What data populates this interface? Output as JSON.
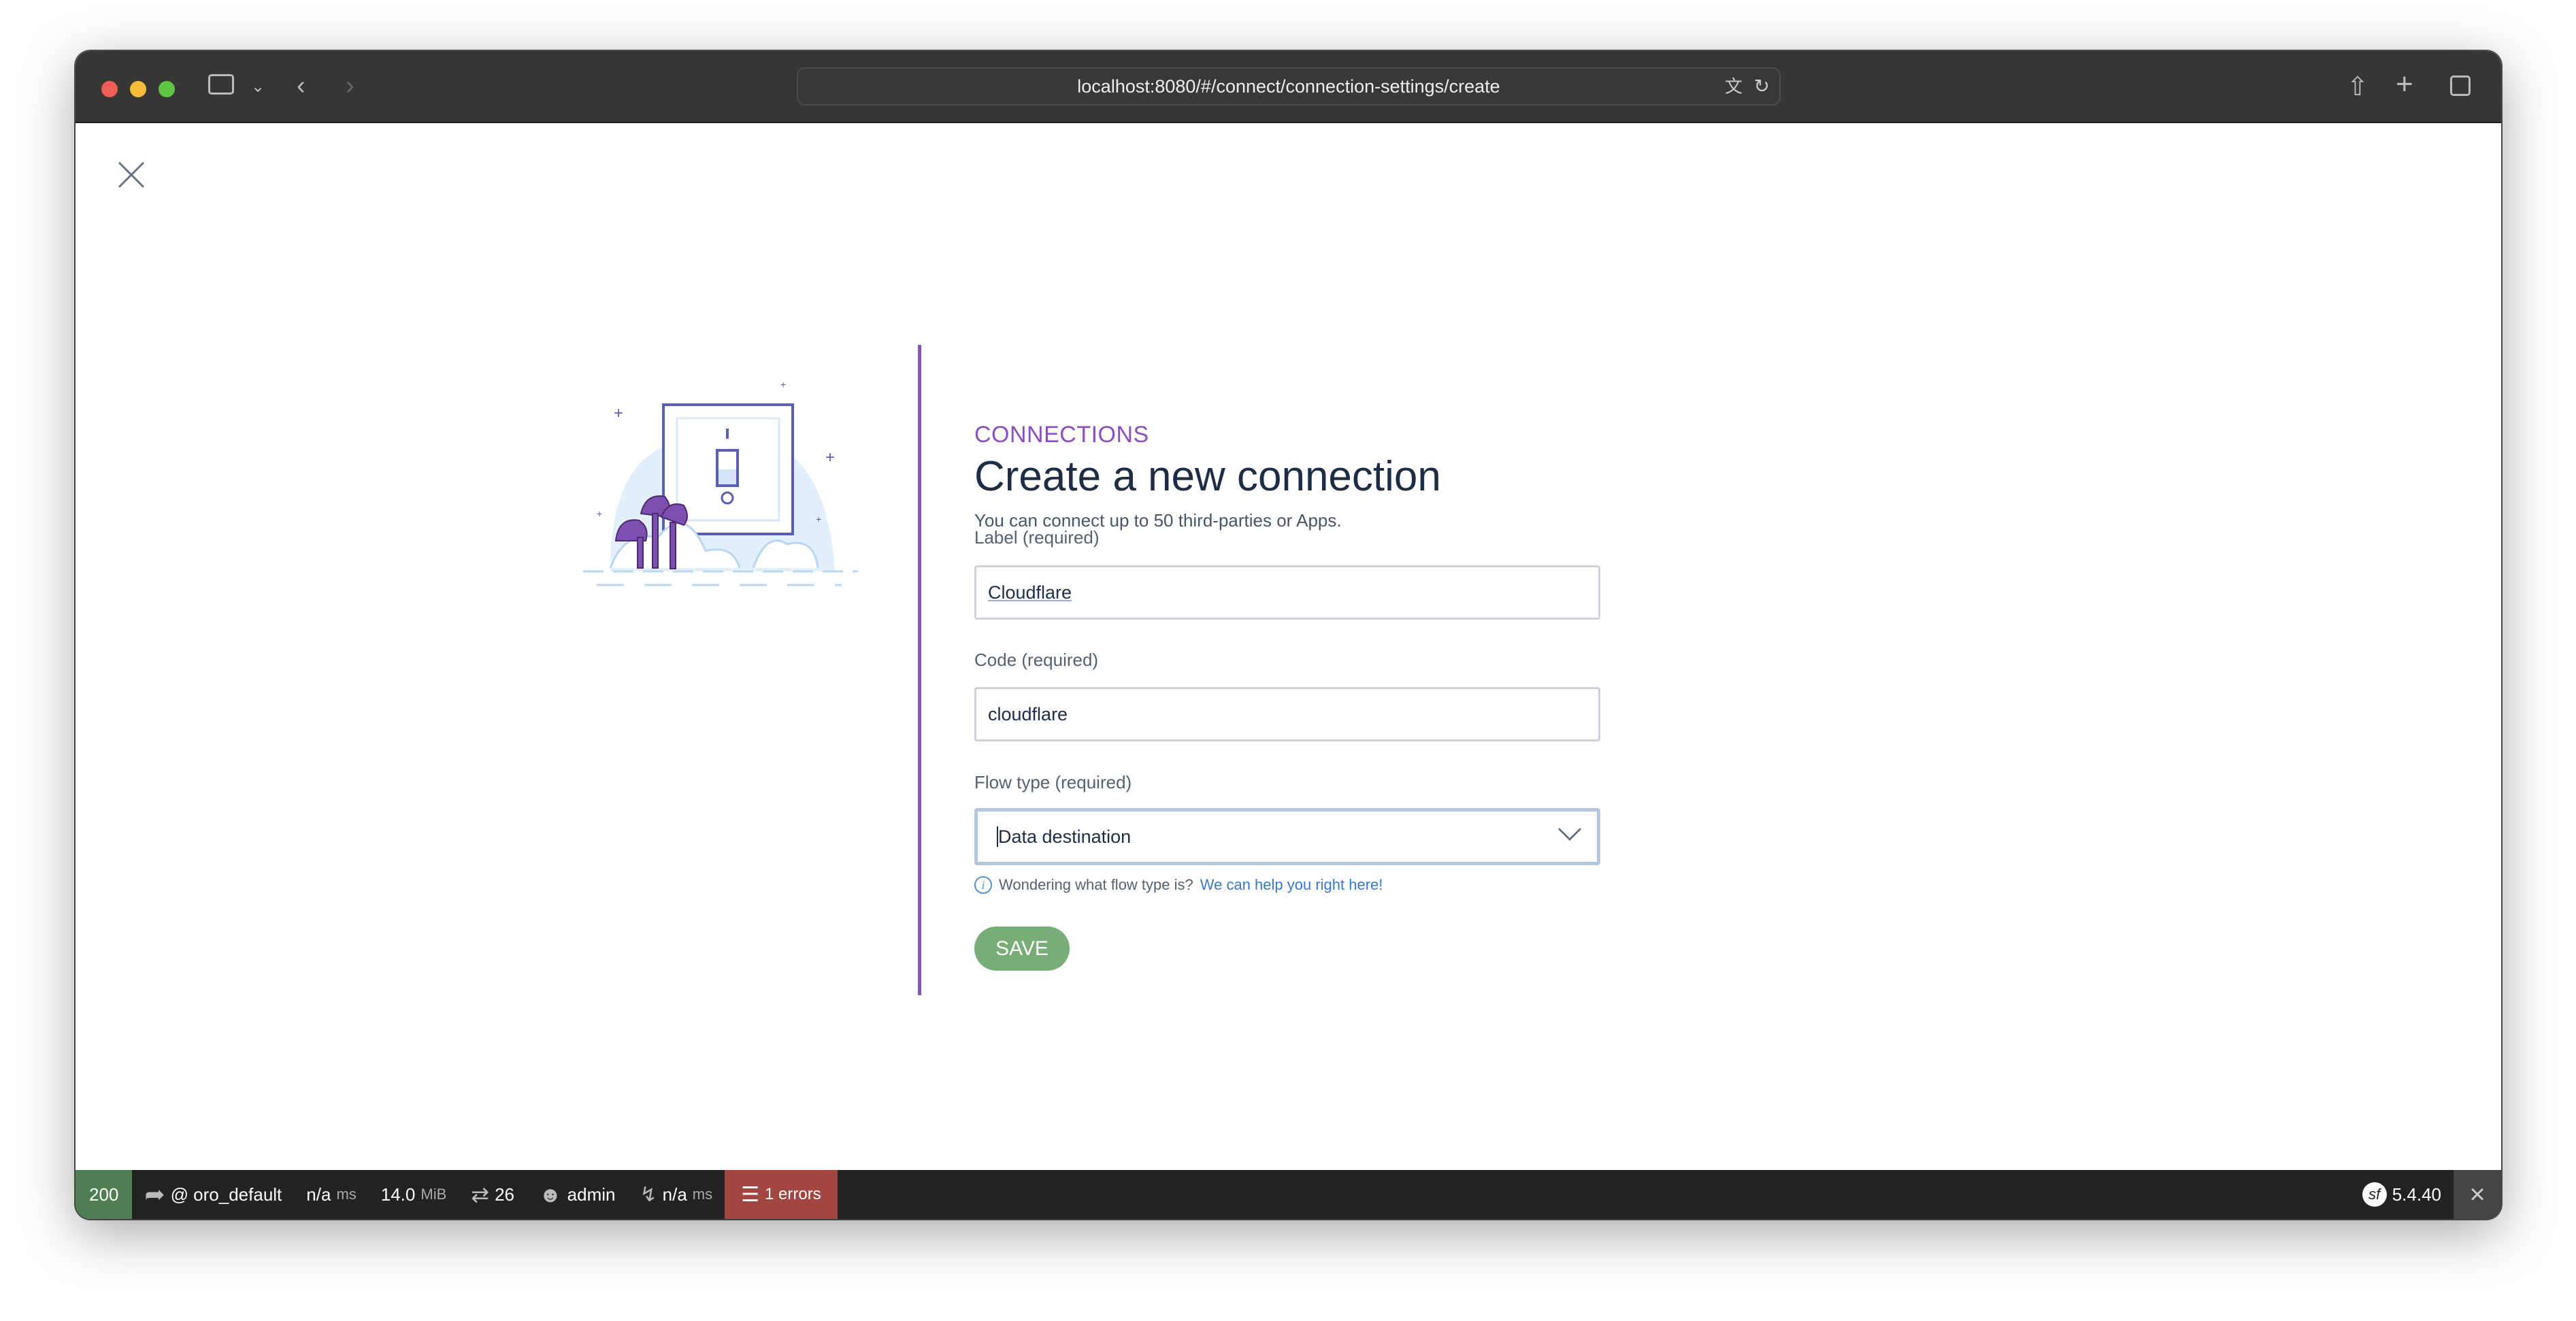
{
  "browser": {
    "url": "localhost:8080/#/connect/connection-settings/create"
  },
  "page": {
    "eyebrow": "CONNECTIONS",
    "title": "Create a new connection",
    "subtitle": "You can connect up to 50 third-parties or Apps.",
    "fields": [
      {
        "label": "Label (required)",
        "value": "Cloudflare"
      },
      {
        "label": "Code (required)",
        "value": "cloudflare"
      },
      {
        "label": "Flow type (required)",
        "value": "Data destination"
      }
    ],
    "help_text": "Wondering what flow type is?",
    "help_link": "We can help you right here!",
    "save_label": "SAVE",
    "accent": "#8c4fc0",
    "save_color": "#78ad78"
  },
  "debug": {
    "status": "200",
    "route": "@ oro_default",
    "time": "n/a",
    "time_unit": "ms",
    "memory": "14.0",
    "memory_unit": "MiB",
    "requests": "26",
    "user": "admin",
    "ajax_time": "n/a",
    "ajax_unit": "ms",
    "errors": "1 errors",
    "version": "5.4.40"
  }
}
